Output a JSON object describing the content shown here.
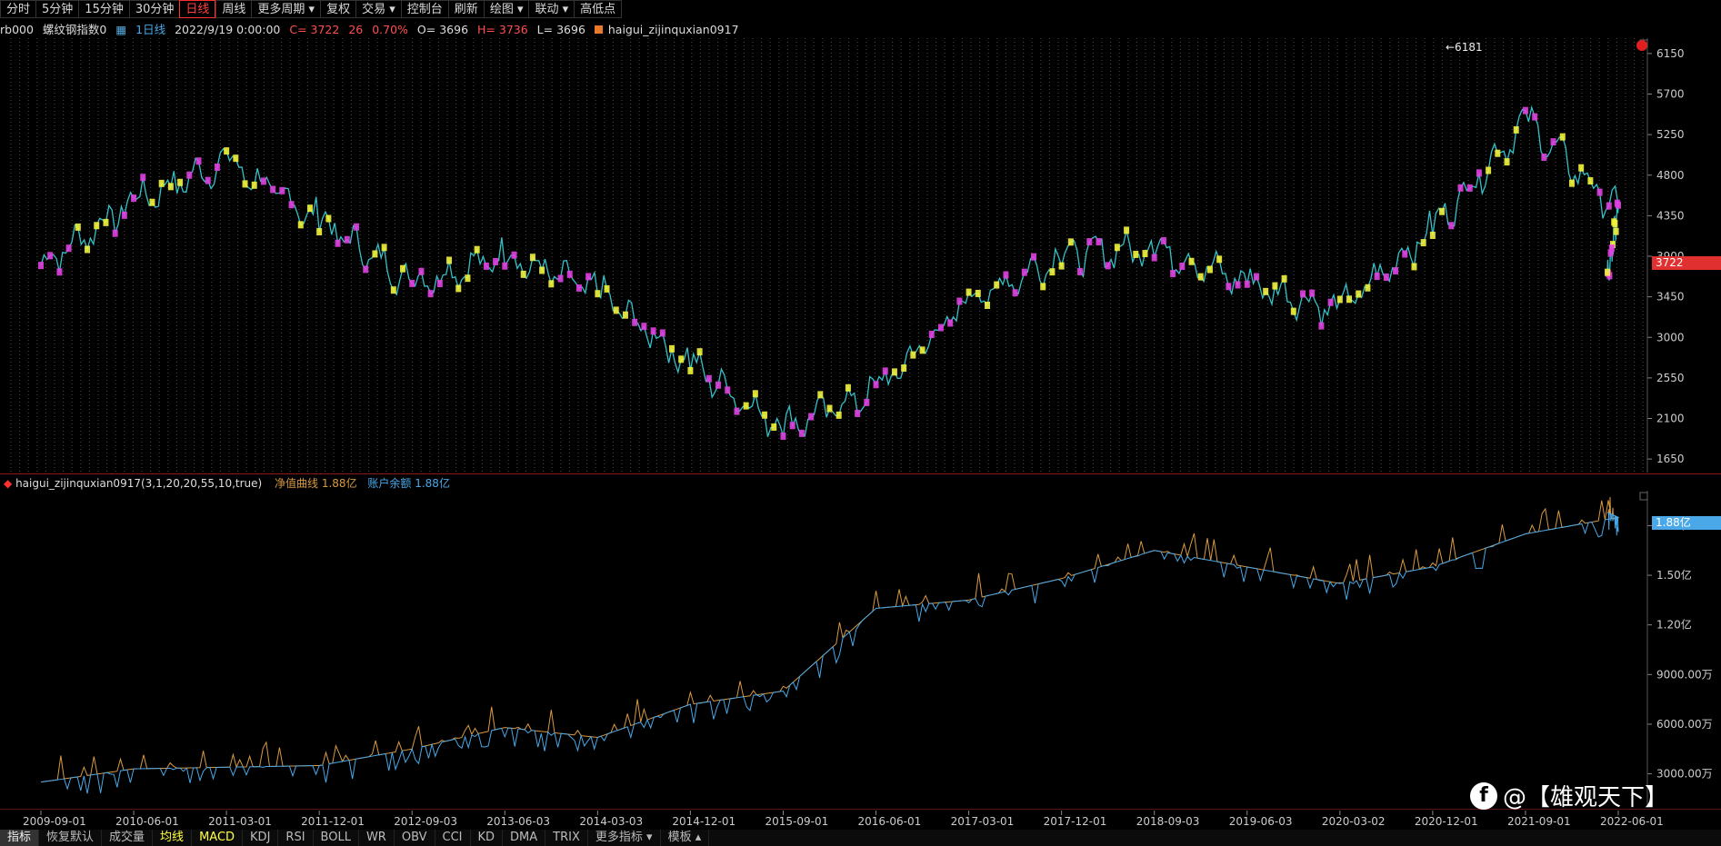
{
  "toolbar": {
    "buttons": [
      "分时",
      "5分钟",
      "15分钟",
      "30分钟",
      "日线",
      "周线",
      "更多周期 ▾",
      "复权",
      "交易 ▾",
      "控制台",
      "刷新",
      "绘图 ▾",
      "联动 ▾",
      "高低点"
    ],
    "active_index": 4
  },
  "info": {
    "symbol": "rb000",
    "name": "螺纹钢指数0",
    "period": "1日线",
    "datetime": "2022/9/19 0:00:00",
    "close": "C= 3722",
    "change": "26",
    "pct": "0.70%",
    "open": "O= 3696",
    "high": "H= 3736",
    "low": "L= 3696",
    "indicator": "haigui_zijinquxian0917"
  },
  "main_chart": {
    "y_ticks": [
      6150,
      5700,
      5250,
      4800,
      4350,
      3900,
      3450,
      3000,
      2550,
      2100,
      1650
    ],
    "ylim": [
      1500,
      6300
    ],
    "current_price": "3722",
    "peak_label": "←6181"
  },
  "indicator_panel": {
    "title": "haigui_zijinquxian0917(3,1,20,20,55,10,true)",
    "series1_label": "净值曲线 1.88亿",
    "series2_label": "账户余额 1.88亿",
    "y_ticks": [
      "1.80亿",
      "1.50亿",
      "1.20亿",
      "9000.00万",
      "6000.00万",
      "3000.00万"
    ],
    "current_value": "1.88亿"
  },
  "x_axis": [
    "2009-09-01",
    "2010-06-01",
    "2011-03-01",
    "2011-12-01",
    "2012-09-03",
    "2013-06-03",
    "2014-03-03",
    "2014-12-01",
    "2015-09-01",
    "2016-06-01",
    "2017-03-01",
    "2017-12-01",
    "2018-09-03",
    "2019-06-03",
    "2020-03-02",
    "2020-12-01",
    "2021-09-01",
    "2022-06-01"
  ],
  "bottom_tabs": {
    "items": [
      "指标",
      "恢复默认",
      "成交量",
      "均线",
      "MACD",
      "KDJ",
      "RSI",
      "BOLL",
      "WR",
      "OBV",
      "CCI",
      "KD",
      "DMA",
      "TRIX",
      "更多指标 ▾",
      "模板 ▴"
    ],
    "selected_index": 0,
    "highlight_indices": [
      3,
      4
    ]
  },
  "watermark": "@【雄观天下】",
  "chart_data": {
    "type": "line",
    "title": "",
    "series": [
      {
        "name": "",
        "x": [
          "2009-09-01",
          "2010-06-01",
          "2011-03-01",
          "2011-12-01",
          "2012-09-03",
          "2013-06-03",
          "2014-03-03",
          "2014-12-01",
          "2015-09-01",
          "2016-06-01",
          "2017-03-01",
          "2017-12-01",
          "2018-09-03",
          "2019-06-03",
          "2020-03-02",
          "2020-12-01",
          "2021-09-01",
          "2022-06-01",
          "2022-09-19"
        ],
        "values": [
          3800,
          4500,
          4950,
          4300,
          3600,
          3900,
          3500,
          2700,
          2000,
          2400,
          3400,
          3900,
          4000,
          3600,
          3300,
          4200,
          5400,
          4400,
          3722
        ]
      },
      {
        "name": "净值曲线",
        "x": [
          "2009-09-01",
          "2010-06-01",
          "2011-03-01",
          "2011-12-01",
          "2012-09-03",
          "2013-06-03",
          "2014-03-03",
          "2014-12-01",
          "2015-09-01",
          "2016-06-01",
          "2017-03-01",
          "2017-12-01",
          "2018-09-03",
          "2019-06-03",
          "2020-03-02",
          "2020-12-01",
          "2021-09-01",
          "2022-06-01",
          "2022-09-19"
        ],
        "values": [
          0.25,
          0.33,
          0.34,
          0.35,
          0.45,
          0.58,
          0.52,
          0.72,
          0.8,
          1.3,
          1.35,
          1.48,
          1.65,
          1.55,
          1.45,
          1.55,
          1.75,
          1.85,
          1.88
        ]
      }
    ]
  }
}
